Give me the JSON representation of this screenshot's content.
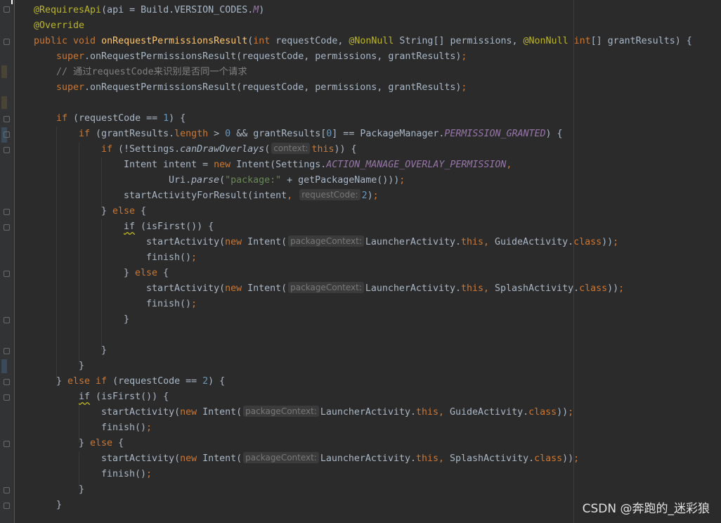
{
  "editor": {
    "lines": [
      {
        "indent": 0,
        "tokens": [
          [
            "ann",
            "@RequiresApi"
          ],
          [
            "",
            "(api = Build.VERSION_CODES."
          ],
          [
            "const",
            "M"
          ],
          [
            "",
            ")"
          ]
        ]
      },
      {
        "indent": 0,
        "tokens": [
          [
            "ann",
            "@Override"
          ]
        ]
      },
      {
        "indent": 0,
        "tokens": [
          [
            "kw",
            "public void "
          ],
          [
            "fn",
            "onRequestPermissionsResult"
          ],
          [
            "",
            "("
          ],
          [
            "kw",
            "int "
          ],
          [
            "",
            "requestCode, "
          ],
          [
            "ann",
            "@NonNull "
          ],
          [
            "",
            "String[] permissions, "
          ],
          [
            "ann",
            "@NonNull "
          ],
          [
            "kw",
            "int"
          ],
          [
            "",
            "[] grantResults) {"
          ]
        ]
      },
      {
        "indent": 1,
        "tokens": [
          [
            "sup",
            "super"
          ],
          [
            "",
            ".onRequestPermissionsResult(requestCode, permissions, grantResults)"
          ],
          [
            "kw",
            ";"
          ]
        ]
      },
      {
        "indent": 1,
        "tokens": [
          [
            "cmt",
            "// 通过requestCode来识别是否同一个请求"
          ]
        ]
      },
      {
        "indent": 1,
        "tokens": [
          [
            "sup",
            "super"
          ],
          [
            "",
            ".onRequestPermissionsResult(requestCode, permissions, grantResults)"
          ],
          [
            "kw",
            ";"
          ]
        ]
      },
      {
        "indent": 0,
        "tokens": []
      },
      {
        "indent": 1,
        "tokens": [
          [
            "kw",
            "if "
          ],
          [
            "",
            "(requestCode == "
          ],
          [
            "num",
            "1"
          ],
          [
            "",
            ") {"
          ]
        ]
      },
      {
        "indent": 2,
        "tokens": [
          [
            "kw",
            "if "
          ],
          [
            "",
            "(grantResults."
          ],
          [
            "kw",
            "length "
          ],
          [
            "",
            "> "
          ],
          [
            "num",
            "0 "
          ],
          [
            "",
            "&& grantResults["
          ],
          [
            "num",
            "0"
          ],
          [
            "",
            "] == PackageManager."
          ],
          [
            "const",
            "PERMISSION_GRANTED"
          ],
          [
            "",
            ") {"
          ]
        ]
      },
      {
        "indent": 3,
        "tokens": [
          [
            "kw",
            "if "
          ],
          [
            "",
            "(!Settings."
          ],
          [
            "ital",
            "canDrawOverlays"
          ],
          [
            "",
            "("
          ],
          [
            "hint",
            "context:"
          ],
          [
            "kw",
            "this"
          ],
          [
            "",
            ")) {"
          ]
        ]
      },
      {
        "indent": 4,
        "tokens": [
          [
            "",
            "Intent intent = "
          ],
          [
            "kw",
            "new "
          ],
          [
            "",
            "Intent(Settings."
          ],
          [
            "const",
            "ACTION_MANAGE_OVERLAY_PERMISSION"
          ],
          [
            "kw",
            ","
          ]
        ]
      },
      {
        "indent": 6,
        "tokens": [
          [
            "",
            "Uri."
          ],
          [
            "ital",
            "parse"
          ],
          [
            "",
            "("
          ],
          [
            "str",
            "\"package:\" "
          ],
          [
            "",
            "+ getPackageName()))"
          ],
          [
            "kw",
            ";"
          ]
        ]
      },
      {
        "indent": 4,
        "tokens": [
          [
            "",
            "startActivityForResult(intent"
          ],
          [
            "kw",
            ", "
          ],
          [
            "hint",
            "requestCode:"
          ],
          [
            "num",
            "2"
          ],
          [
            "",
            ")"
          ],
          [
            "kw",
            ";"
          ]
        ]
      },
      {
        "indent": 3,
        "tokens": [
          [
            "",
            "} "
          ],
          [
            "kw",
            "else "
          ],
          [
            "",
            "{"
          ]
        ]
      },
      {
        "indent": 4,
        "tokens": [
          [
            "squig",
            "if"
          ],
          [
            "kw",
            " "
          ],
          [
            "",
            "(isFirst()) {"
          ]
        ]
      },
      {
        "indent": 5,
        "tokens": [
          [
            "",
            "startActivity("
          ],
          [
            "kw",
            "new "
          ],
          [
            "",
            "Intent("
          ],
          [
            "hint",
            "packageContext:"
          ],
          [
            "",
            "LauncherActivity."
          ],
          [
            "kw",
            "this, "
          ],
          [
            "",
            "GuideActivity."
          ],
          [
            "kw",
            "class"
          ],
          [
            "",
            "))"
          ],
          [
            "kw",
            ";"
          ]
        ]
      },
      {
        "indent": 5,
        "tokens": [
          [
            "",
            "finish()"
          ],
          [
            "kw",
            ";"
          ]
        ]
      },
      {
        "indent": 4,
        "tokens": [
          [
            "",
            "} "
          ],
          [
            "kw",
            "else "
          ],
          [
            "",
            "{"
          ]
        ]
      },
      {
        "indent": 5,
        "tokens": [
          [
            "",
            "startActivity("
          ],
          [
            "kw",
            "new "
          ],
          [
            "",
            "Intent("
          ],
          [
            "hint",
            "packageContext:"
          ],
          [
            "",
            "LauncherActivity."
          ],
          [
            "kw",
            "this, "
          ],
          [
            "",
            "SplashActivity."
          ],
          [
            "kw",
            "class"
          ],
          [
            "",
            "))"
          ],
          [
            "kw",
            ";"
          ]
        ]
      },
      {
        "indent": 5,
        "tokens": [
          [
            "",
            "finish()"
          ],
          [
            "kw",
            ";"
          ]
        ]
      },
      {
        "indent": 4,
        "tokens": [
          [
            "",
            "}"
          ]
        ]
      },
      {
        "indent": 0,
        "tokens": []
      },
      {
        "indent": 3,
        "tokens": [
          [
            "",
            "}"
          ]
        ]
      },
      {
        "indent": 2,
        "tokens": [
          [
            "",
            "}"
          ]
        ]
      },
      {
        "indent": 1,
        "tokens": [
          [
            "",
            "} "
          ],
          [
            "kw",
            "else if "
          ],
          [
            "",
            "(requestCode == "
          ],
          [
            "num",
            "2"
          ],
          [
            "",
            ") {"
          ]
        ]
      },
      {
        "indent": 2,
        "tokens": [
          [
            "squig",
            "if"
          ],
          [
            "kw",
            " "
          ],
          [
            "",
            "(isFirst()) {"
          ]
        ]
      },
      {
        "indent": 3,
        "tokens": [
          [
            "",
            "startActivity("
          ],
          [
            "kw",
            "new "
          ],
          [
            "",
            "Intent("
          ],
          [
            "hint",
            "packageContext:"
          ],
          [
            "",
            "LauncherActivity."
          ],
          [
            "kw",
            "this, "
          ],
          [
            "",
            "GuideActivity."
          ],
          [
            "kw",
            "class"
          ],
          [
            "",
            "))"
          ],
          [
            "kw",
            ";"
          ]
        ]
      },
      {
        "indent": 3,
        "tokens": [
          [
            "",
            "finish()"
          ],
          [
            "kw",
            ";"
          ]
        ]
      },
      {
        "indent": 2,
        "tokens": [
          [
            "",
            "} "
          ],
          [
            "kw",
            "else "
          ],
          [
            "",
            "{"
          ]
        ]
      },
      {
        "indent": 3,
        "tokens": [
          [
            "",
            "startActivity("
          ],
          [
            "kw",
            "new "
          ],
          [
            "",
            "Intent("
          ],
          [
            "hint",
            "packageContext:"
          ],
          [
            "",
            "LauncherActivity."
          ],
          [
            "kw",
            "this, "
          ],
          [
            "",
            "SplashActivity."
          ],
          [
            "kw",
            "class"
          ],
          [
            "",
            "))"
          ],
          [
            "kw",
            ";"
          ]
        ]
      },
      {
        "indent": 3,
        "tokens": [
          [
            "",
            "finish()"
          ],
          [
            "kw",
            ";"
          ]
        ]
      },
      {
        "indent": 2,
        "tokens": [
          [
            "",
            "}"
          ]
        ]
      },
      {
        "indent": 1,
        "tokens": [
          [
            "",
            "}"
          ]
        ]
      }
    ]
  },
  "watermark": "CSDN @奔跑的_迷彩狼",
  "colors": {
    "background": "#2b2b2b",
    "keyword": "#cc7832",
    "annotation": "#bbb529",
    "method": "#ffc66d",
    "number": "#6897bb",
    "string": "#6a8759",
    "comment": "#808080",
    "constant": "#9876aa"
  }
}
